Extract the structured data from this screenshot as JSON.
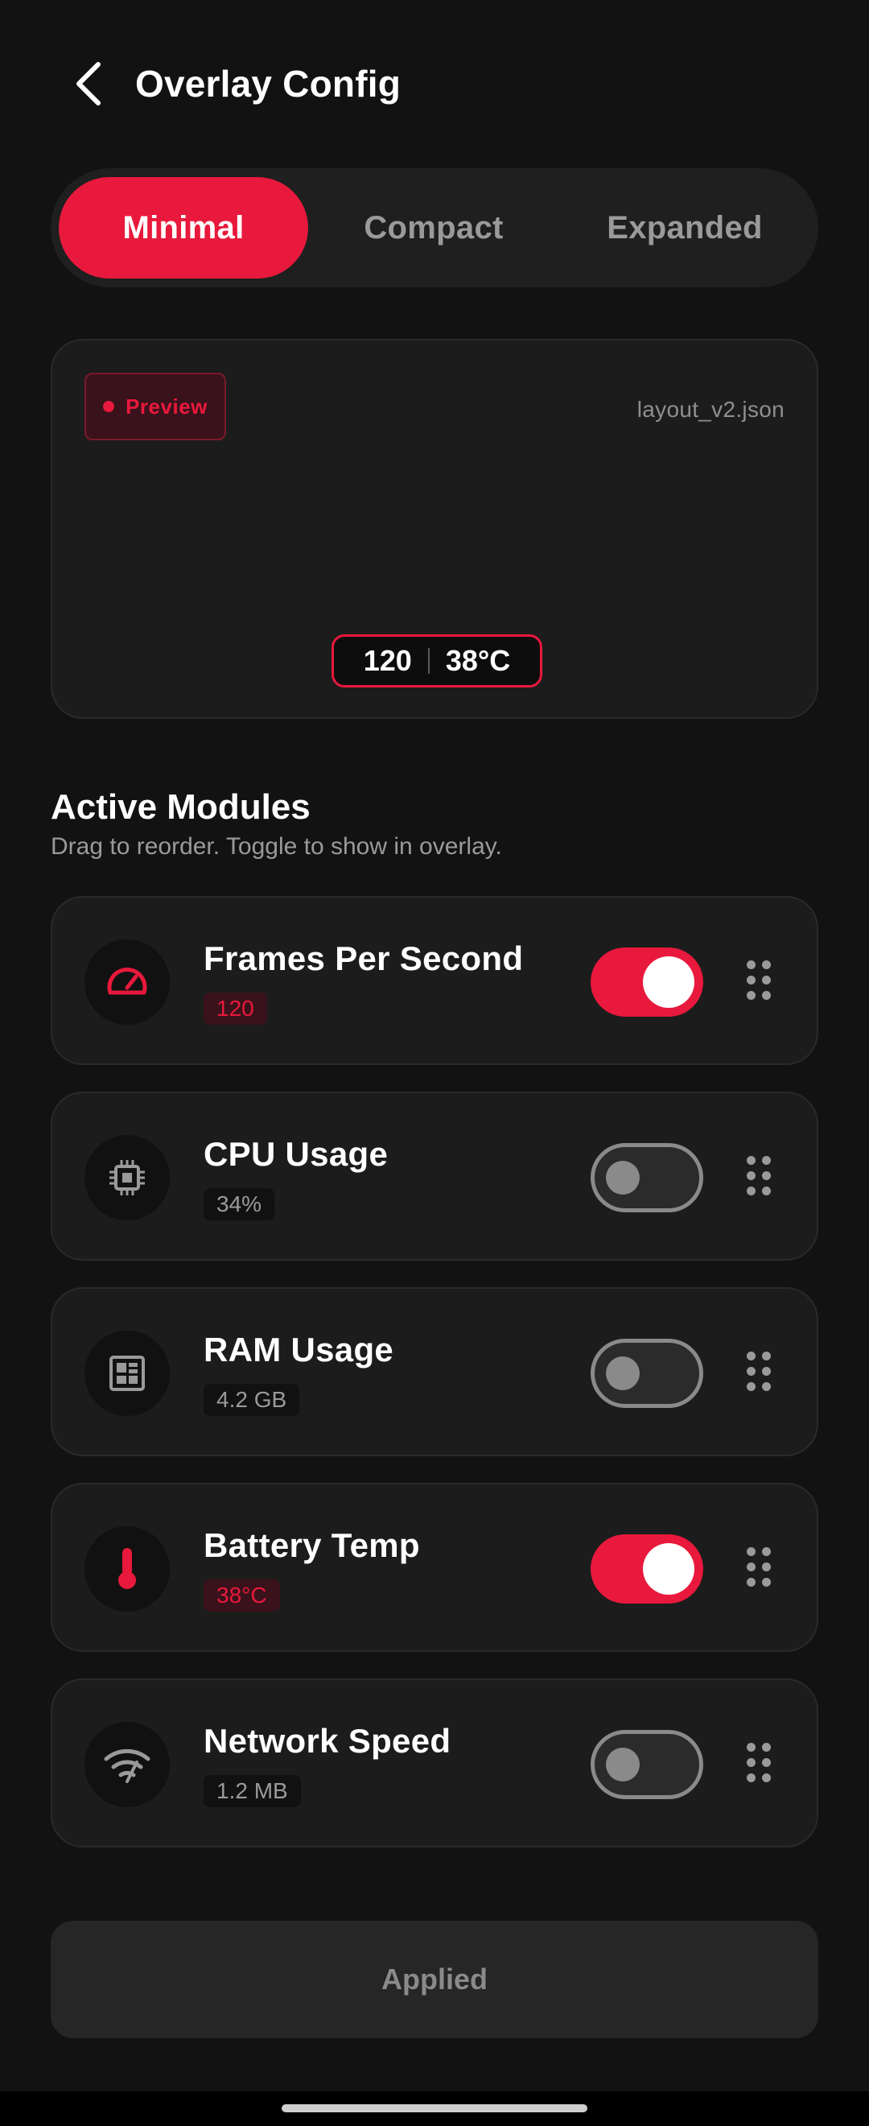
{
  "header": {
    "title": "Overlay Config",
    "back_icon": "chevron-left-icon"
  },
  "segments": [
    {
      "label": "Minimal",
      "active": true
    },
    {
      "label": "Compact",
      "active": false
    },
    {
      "label": "Expanded",
      "active": false
    }
  ],
  "preview": {
    "badge": "Preview",
    "file": "layout_v2.json",
    "values": [
      "120",
      "38°C"
    ]
  },
  "modules_section": {
    "title": "Active Modules",
    "subtitle": "Drag to reorder. Toggle to show in overlay."
  },
  "modules": [
    {
      "name": "Frames Per Second",
      "value": "120",
      "enabled": true,
      "icon": "speedometer-icon"
    },
    {
      "name": "CPU Usage",
      "value": "34%",
      "enabled": false,
      "icon": "cpu-icon"
    },
    {
      "name": "RAM Usage",
      "value": "4.2 GB",
      "enabled": false,
      "icon": "memory-icon"
    },
    {
      "name": "Battery Temp",
      "value": "38°C",
      "enabled": true,
      "icon": "thermometer-icon"
    },
    {
      "name": "Network Speed",
      "value": "1.2 MB",
      "enabled": false,
      "icon": "wifi-icon"
    }
  ],
  "apply_button": {
    "label": "Applied"
  },
  "colors": {
    "accent": "#e8193c",
    "background": "#121212",
    "card": "#1c1c1c",
    "muted_text": "#9a9a9a"
  }
}
